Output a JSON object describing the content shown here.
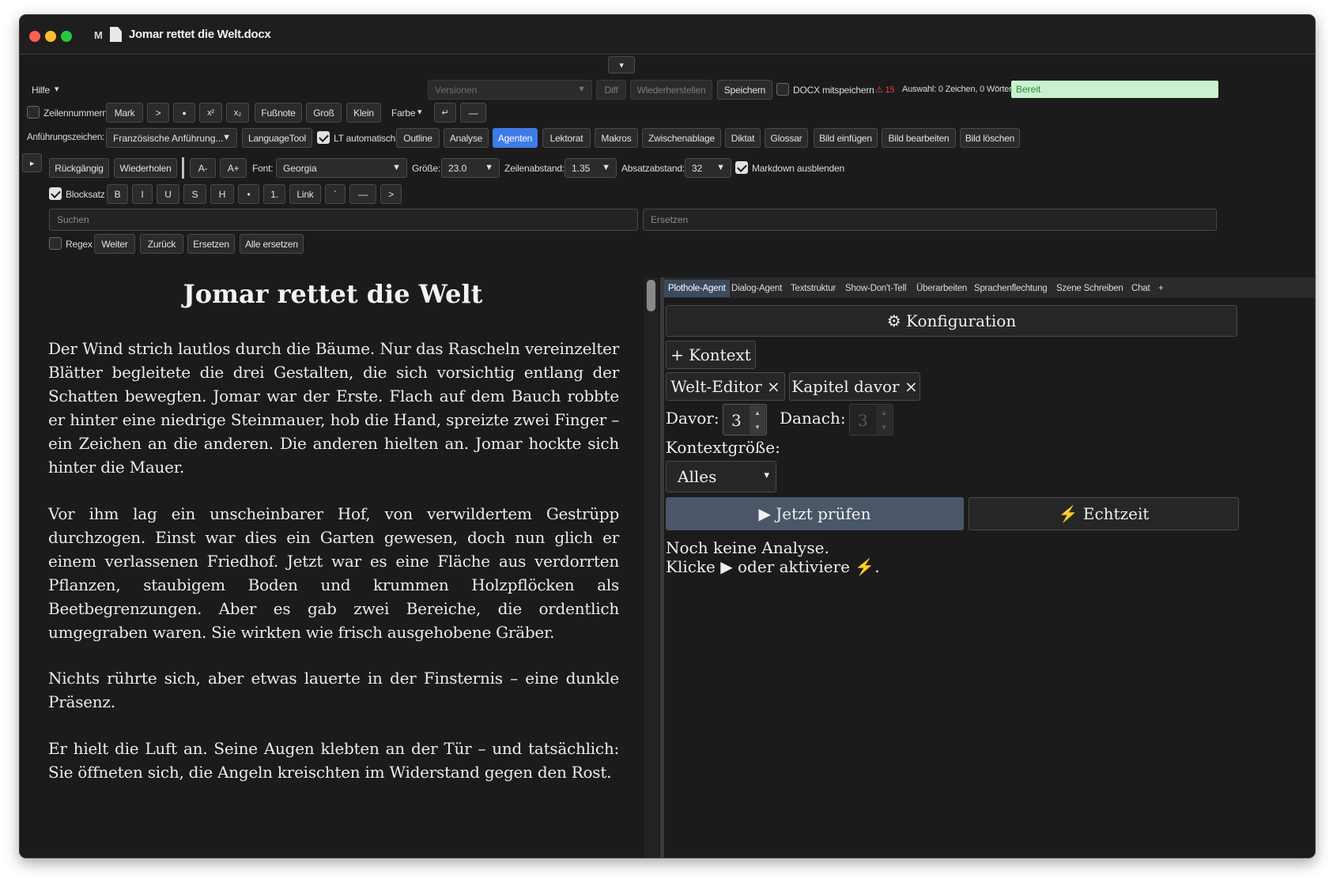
{
  "window": {
    "menu_letter": "M",
    "title": "Jomar rettet die Welt.docx"
  },
  "topbar": {
    "collapse_glyph": "▾",
    "help_menu": "Hilfe",
    "help_arrow": "▾",
    "versions_placeholder": "Versionen",
    "diff_label": "Diff",
    "restore_label": "Wiederherstellen",
    "save_label": "Speichern",
    "docx_save_label": "DOCX mitspeichern",
    "warning_count": "⚠ 15",
    "selection_info": "Auswahl: 0 Zeichen, 0 Wörter",
    "status": "Bereit"
  },
  "row2": {
    "line_numbers_label": "Zeilennummern",
    "mark": "Mark",
    "quote_gt": ">",
    "bullet": "●",
    "superscript": "x²",
    "subscript": "x₂",
    "footnote": "Fußnote",
    "upper": "Groß",
    "lower": "Klein",
    "color_label": "Farbe",
    "color_arrow": "▾",
    "linebreak": "↵",
    "rule": "—"
  },
  "row3": {
    "quotes_label": "Anführungszeichen:",
    "quotes_value": "Französische Anführung...",
    "languagetool": "LanguageTool",
    "lt_auto_label": "LT automatisch",
    "buttons": [
      "Outline",
      "Analyse",
      "Agenten",
      "Lektorat",
      "Makros",
      "Zwischenablage",
      "Diktat",
      "Glossar",
      "Bild einfügen",
      "Bild bearbeiten",
      "Bild löschen"
    ]
  },
  "row4": {
    "panel_toggle": "▸",
    "undo": "Rückgängig",
    "redo": "Wiederholen",
    "font_smaller": "A-",
    "font_larger": "A+",
    "font_label": "Font:",
    "font_value": "Georgia",
    "size_label": "Größe:",
    "size_value": "23.0",
    "line_spacing_label": "Zeilenabstand:",
    "line_spacing_value": "1.35",
    "para_spacing_label": "Absatzabstand:",
    "para_spacing_value": "32",
    "hide_markdown_label": "Markdown ausblenden"
  },
  "row5": {
    "justify_label": "Blocksatz",
    "bold": "B",
    "italic": "I",
    "underline": "U",
    "strike": "S",
    "heading": "H",
    "bullet_list": "•",
    "numbered_list": "1.",
    "link": "Link",
    "code": "`",
    "hr": "—",
    "quote": ">"
  },
  "search": {
    "search_placeholder": "Suchen",
    "replace_placeholder": "Ersetzen",
    "regex_label": "Regex",
    "next": "Weiter",
    "prev": "Zurück",
    "replace": "Ersetzen",
    "replace_all": "Alle ersetzen"
  },
  "editor": {
    "title": "Jomar rettet die Welt",
    "paragraphs": [
      "Der Wind strich lautlos durch die Bäume. Nur das Rascheln vereinzelter Blätter begleitete die drei Gestalten, die sich vorsichtig entlang der Schatten bewegten. Jomar war der Erste. Flach auf dem Bauch robbte er hinter eine niedrige Steinmauer, hob die Hand, spreizte zwei Finger – ein Zeichen an die anderen. Die anderen hielten an. Jomar hockte sich hinter die Mauer.",
      "Vor ihm lag ein unscheinbarer Hof, von verwildertem Gestrüpp durchzogen. Einst war dies ein Garten gewesen, doch nun glich er einem verlassenen Friedhof. Jetzt war es eine Fläche aus verdorrten Pflanzen, staubigem Boden und krummen Holzpflöcken als Beetbegrenzungen. Aber es gab zwei Bereiche, die ordentlich umgegraben waren. Sie wirkten wie frisch ausgehobene Gräber.",
      "Nichts rührte sich, aber etwas lauerte in der Finsternis – eine dunkle Präsenz.",
      "Er hielt die Luft an. Seine Augen klebten an der Tür – und tatsächlich: Sie öffneten sich, die Angeln kreischten im Widerstand gegen den Rost."
    ]
  },
  "agent_panel": {
    "tabs": [
      "Plothole-Agent",
      "Dialog-Agent",
      "Textstruktur",
      "Show-Don't-Tell",
      "Überarbeiten",
      "Sprachenflechtung",
      "Szene Schreiben",
      "Chat",
      "+"
    ],
    "config": "⚙ Konfiguration",
    "add_context": "+ Kontext",
    "chips": [
      "Welt-Editor ×",
      "Kapitel davor ×"
    ],
    "before_label": "Davor:",
    "before_value": "3",
    "after_label": "Danach:",
    "after_value": "3",
    "spin_up": "▲",
    "spin_down": "▼",
    "context_size_label": "Kontextgröße:",
    "context_size_value": "Alles",
    "context_size_arrow": "▾",
    "check_now": "▶ Jetzt prüfen",
    "realtime": "⚡ Echtzeit",
    "result_line1": "Noch keine Analyse.",
    "result_line2": "Klicke ▶ oder aktiviere ⚡."
  },
  "colors": {
    "background": "#1b1b1b",
    "accent": "#3d7ce6",
    "status_bg": "#c9f1cf",
    "status_text": "#2d8a3c",
    "warning": "#e04a3a",
    "primary_action": "#4b5668"
  }
}
